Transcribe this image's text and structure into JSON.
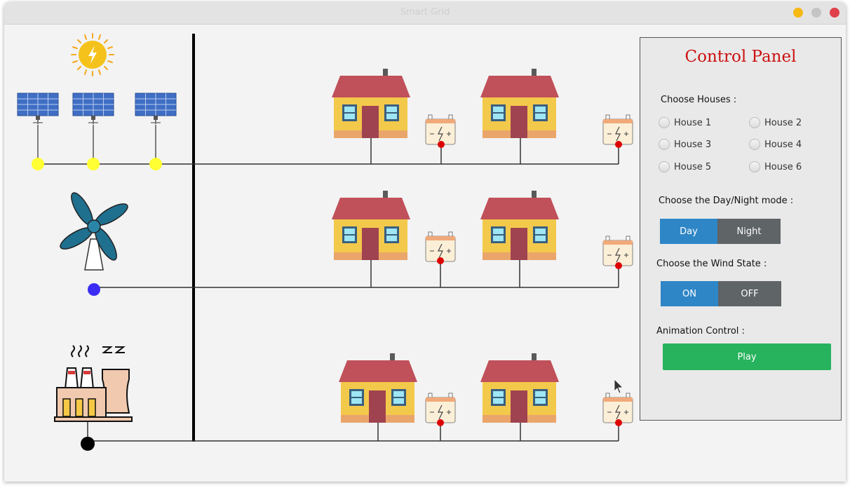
{
  "window": {
    "title": "Smart Grid",
    "buttons": [
      {
        "name": "minimize",
        "color": "#f6b912"
      },
      {
        "name": "maximize",
        "color": "#c4c4c4"
      },
      {
        "name": "close",
        "color": "#e0404a"
      }
    ]
  },
  "panel": {
    "title": "Control Panel",
    "choose_houses": "Choose Houses :",
    "houses": [
      "House 1",
      "House 2",
      "House 3",
      "House 4",
      "House 5",
      "House 6"
    ],
    "day_night_label": "Choose the Day/Night mode :",
    "day_label": "Day",
    "night_label": "Night",
    "wind_label": "Choose the Wind State :",
    "on_label": "ON",
    "off_label": "OFF",
    "animation_label": "Animation Control :",
    "play_label": "Play"
  },
  "colors": {
    "accent_blue": "#2e86c6",
    "toggle_gray": "#5f6466",
    "play_green": "#27b35d",
    "title_red": "#cc1111",
    "solar_node": "#ffff33",
    "wind_node": "#3b2cf5",
    "plant_node": "#000000",
    "battery_node": "#dd0000"
  }
}
